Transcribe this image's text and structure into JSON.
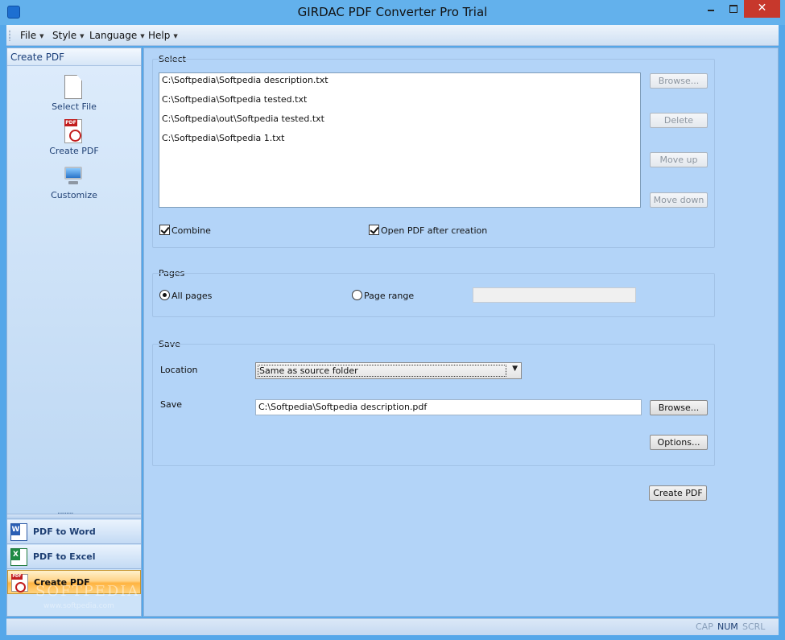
{
  "window": {
    "title": "GIRDAC PDF Converter Pro Trial",
    "close_glyph": "✕"
  },
  "menu": [
    {
      "label": "File"
    },
    {
      "label": "Style"
    },
    {
      "label": "Language"
    },
    {
      "label": "Help"
    }
  ],
  "left_panel": {
    "header": "Create PDF",
    "items": [
      {
        "label": "Select File",
        "icon": "document-icon"
      },
      {
        "label": "Create PDF",
        "icon": "pdf-icon"
      },
      {
        "label": "Customize",
        "icon": "computer-icon"
      }
    ],
    "nav": [
      {
        "label": "PDF to Word",
        "icon": "word-icon",
        "active": false
      },
      {
        "label": "PDF to Excel",
        "icon": "excel-icon",
        "active": false
      },
      {
        "label": "Create PDF",
        "icon": "pdf-icon",
        "active": true
      }
    ],
    "watermark": "SOFTPEDIA",
    "watermark_url": "www.softpedia.com"
  },
  "select_group": {
    "title": "Select",
    "files": [
      "C:\\Softpedia\\Softpedia description.txt",
      "C:\\Softpedia\\Softpedia tested.txt",
      "C:\\Softpedia\\out\\Softpedia tested.txt",
      "C:\\Softpedia\\Softpedia 1.txt"
    ],
    "browse_label": "Browse...",
    "delete_label": "Delete",
    "move_up_label": "Move up",
    "move_down_label": "Move down",
    "combine_label": "Combine",
    "combine_checked": true,
    "open_pdf_label": "Open PDF after creation",
    "open_pdf_checked": true
  },
  "pages_group": {
    "title": "Pages",
    "all_pages_label": "All pages",
    "page_range_label": "Page range",
    "selected": "all",
    "page_range_value": ""
  },
  "save_group": {
    "title": "Save",
    "location_label": "Location",
    "location_value": "Same as source folder",
    "save_label": "Save",
    "save_path": "C:\\Softpedia\\Softpedia description.pdf",
    "browse_label": "Browse...",
    "options_label": "Options..."
  },
  "create_pdf_button": "Create PDF",
  "status": {
    "cap": "CAP",
    "num": "NUM",
    "scrl": "SCRL"
  },
  "colors": {
    "window_frame": "#55a7e9",
    "panel_bg": "#b3d4f8",
    "active_nav": "#ffb441",
    "close_button": "#c7382c"
  }
}
